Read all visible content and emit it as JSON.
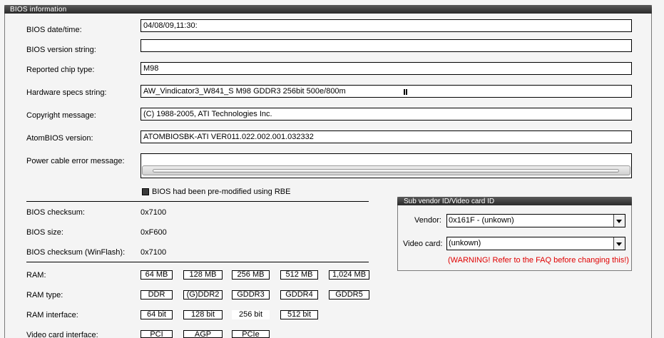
{
  "panel": {
    "title": "BIOS information"
  },
  "fields": {
    "bios_datetime": {
      "label": "BIOS date/time:",
      "value": "04/08/09,11:30:"
    },
    "bios_version": {
      "label": "BIOS version string:",
      "value": ""
    },
    "chip_type": {
      "label": "Reported chip type:",
      "value": "M98"
    },
    "hw_specs": {
      "label": "Hardware specs string:",
      "value": "AW_Vindicator3_W841_S M98 GDDR3 256bit 500e/800m"
    },
    "copyright": {
      "label": "Copyright message:",
      "value": "(C) 1988-2005, ATI Technologies Inc."
    },
    "atombios": {
      "label": "AtomBIOS version:",
      "value": "ATOMBIOSBK-ATI VER011.022.002.001.032332"
    },
    "power_cable": {
      "label": "Power cable error message:",
      "value": ""
    }
  },
  "premodified": {
    "label": "BIOS had been pre-modified using RBE",
    "checked": true
  },
  "info": {
    "checksum": {
      "label": "BIOS checksum:",
      "value": "0x7100"
    },
    "size": {
      "label": "BIOS size:",
      "value": "0xF600"
    },
    "checksum_winflash": {
      "label": "BIOS checksum (WinFlash):",
      "value": "0x7100"
    }
  },
  "ram": {
    "label": "RAM:",
    "options": [
      "64 MB",
      "128 MB",
      "256 MB",
      "512 MB",
      "1,024 MB"
    ]
  },
  "ram_type": {
    "label": "RAM type:",
    "options": [
      "DDR",
      "(G)DDR2",
      "GDDR3",
      "GDDR4",
      "GDDR5"
    ]
  },
  "ram_interface": {
    "label": "RAM interface:",
    "options": [
      "64 bit",
      "128 bit",
      "256 bit",
      "512 bit"
    ]
  },
  "video_interface": {
    "label": "Video card interface:",
    "options": [
      "PCI",
      "AGP",
      "PCIe"
    ]
  },
  "subvendor": {
    "title": "Sub vendor ID/Video card ID",
    "vendor_label": "Vendor:",
    "vendor_value": "0x161F - (unkown)",
    "card_label": "Video card:",
    "card_value": "(unkown)",
    "warning": "(WARNING! Refer to the FAQ before changing this!)",
    "warning_color": "#e00000"
  }
}
